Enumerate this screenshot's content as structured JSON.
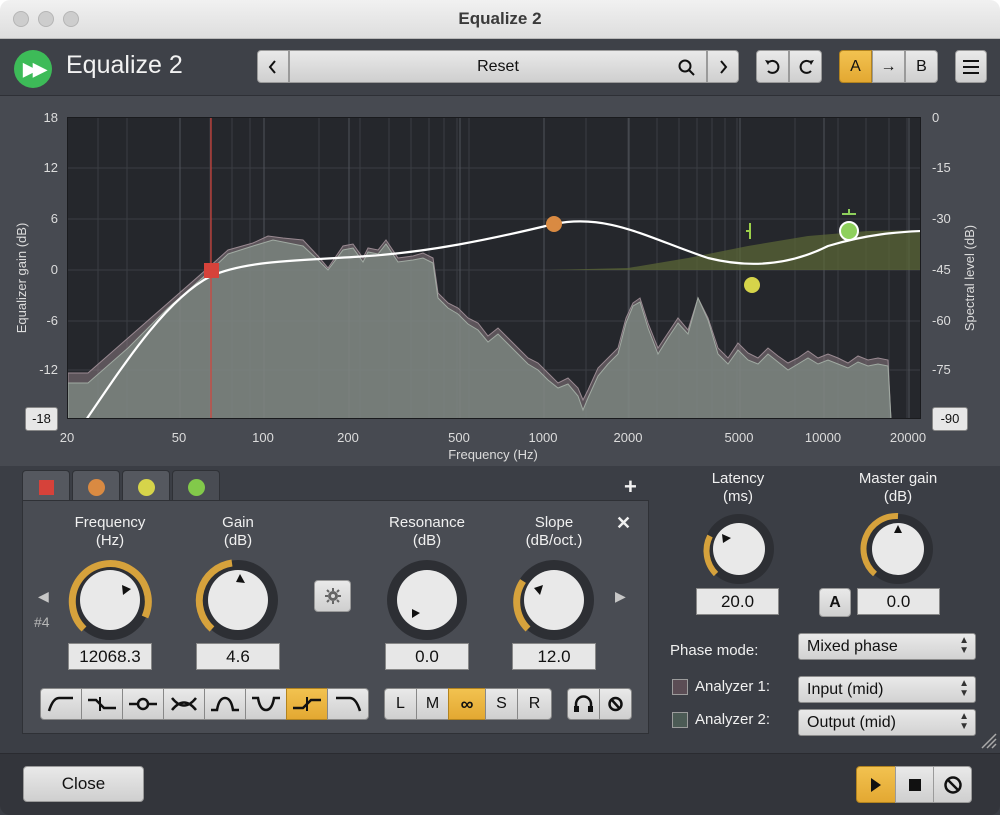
{
  "window": {
    "title": "Equalize 2"
  },
  "header": {
    "app_name": "Equalize 2",
    "preset_name": "Reset",
    "ab": {
      "a": "A",
      "arrow": "→",
      "b": "B"
    }
  },
  "graph": {
    "left_axis_label": "Equalizer gain (dB)",
    "right_axis_label": "Spectral level (dB)",
    "x_axis_label": "Frequency (Hz)",
    "left_ticks": [
      "18",
      "12",
      "6",
      "0",
      "-6",
      "-12"
    ],
    "left_bottom_value": "-18",
    "right_ticks": [
      "0",
      "-15",
      "-30",
      "-45",
      "-60",
      "-75"
    ],
    "right_bottom_value": "-90",
    "x_ticks": [
      "20",
      "50",
      "100",
      "200",
      "500",
      "1000",
      "2000",
      "5000",
      "10000",
      "20000"
    ]
  },
  "bands": {
    "tabs": [
      {
        "color": "#d6423a"
      },
      {
        "color": "#d98a42"
      },
      {
        "color": "#d6d44a"
      },
      {
        "color": "#82c94a"
      }
    ],
    "index_label": "#4",
    "frequency": {
      "label1": "Frequency",
      "label2": "(Hz)",
      "value": "12068.3"
    },
    "gain": {
      "label1": "Gain",
      "label2": "(dB)",
      "value": "4.6"
    },
    "resonance": {
      "label1": "Resonance",
      "label2": "(dB)",
      "value": "0.0"
    },
    "slope": {
      "label1": "Slope",
      "label2": "(dB/oct.)",
      "value": "12.0"
    },
    "channel_buttons": [
      "L",
      "M",
      "∞",
      "S",
      "R"
    ]
  },
  "right_panel": {
    "latency": {
      "label1": "Latency",
      "label2": "(ms)",
      "value": "20.0"
    },
    "master_gain": {
      "label1": "Master gain",
      "label2": "(dB)",
      "value": "0.0",
      "auto_label": "A"
    },
    "phase_mode": {
      "label": "Phase mode:",
      "value": "Mixed phase"
    },
    "analyzer1": {
      "label": "Analyzer 1:",
      "value": "Input (mid)"
    },
    "analyzer2": {
      "label": "Analyzer 2:",
      "value": "Output (mid)"
    }
  },
  "footer": {
    "close_label": "Close"
  }
}
